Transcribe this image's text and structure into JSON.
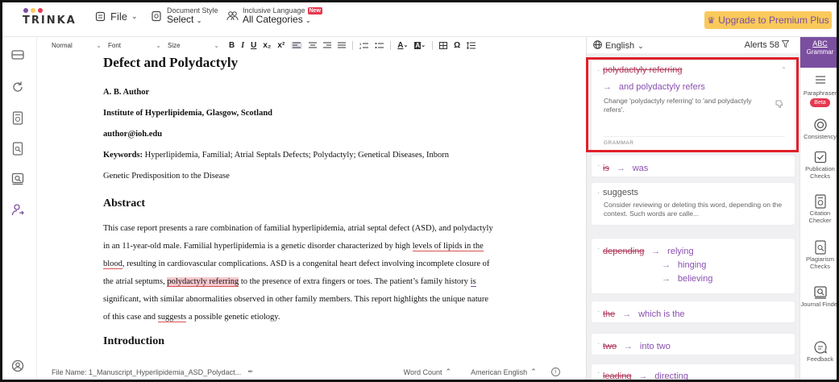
{
  "app": {
    "logo_text": "TRINKA",
    "logo_colors": [
      "#7b4fa0",
      "#f9c95b",
      "#e53950"
    ]
  },
  "topbar": {
    "file_label": "File",
    "doc_style_small": "Document Style",
    "doc_style_main": "Select",
    "inclusive_small": "Inclusive Language",
    "inclusive_badge": "New",
    "inclusive_main": "All Categories",
    "premium_label": "Upgrade to Premium Plus"
  },
  "format_toolbar": {
    "style_label": "Normal",
    "font_label": "Font",
    "size_label": "Size",
    "bold": "B",
    "italic": "I",
    "underline": "U",
    "subscript": "x₂",
    "superscript": "x²",
    "omega": "Ω"
  },
  "document": {
    "title": "Defect and Polydactyly",
    "author": "A. B. Author",
    "institute": "Institute of Hyperlipidemia, Glasgow, Scotland",
    "email": "author@ioh.edu",
    "keywords_label": "Keywords:",
    "keywords_text": " Hyperlipidemia, Familial; Atrial Septals Defects; Polydactyly; Genetical Diseases, Inborn",
    "keywords_line2": "Genetic Predisposition to the Disease",
    "abstract_heading": "Abstract",
    "abstract_lines": {
      "l1": "This case report presents a rare combination of familial hyperlipidemia, atrial septal defect (ASD), and polydactyly",
      "l2_a": "in an 11-year-old male. Familial hyperlipidemia is a genetic disorder characterized by high ",
      "l2_b": "levels of lipids in the",
      "l3_a": "blood",
      "l3_b": ", resulting in cardiovascular complications. ASD is a congenital heart defect involving incomplete closure of",
      "l4_a": "the atrial septums, ",
      "l4_hl": "polydactyly referring",
      "l4_b": " to the presence of extra fingers or toes. The patient’s family history ",
      "l4_c": "is",
      "l5": "significant, with similar abnormalities observed in other family members. This report highlights the unique nature",
      "l6_a": "of this case and ",
      "l6_b": "suggests",
      "l6_c": " a possible genetic etiology."
    },
    "intro_heading": "Introduction"
  },
  "statusbar": {
    "file_name": "File Name: 1_Manuscript_Hyperlipidemia_ASD_Polydact...",
    "word_count": "Word Count",
    "language": "American English"
  },
  "panel": {
    "language": "English",
    "alerts_label": "Alerts",
    "alerts_count": "58",
    "cards": [
      {
        "original": "polydactyly referring",
        "replacement": "and polydactyly refers",
        "description": "Change 'polydactyly referring' to 'and polydactyly refers'.",
        "tag": "GRAMMAR"
      },
      {
        "original": "is",
        "replacement": "was"
      },
      {
        "original": "suggests",
        "description": "Consider reviewing or deleting this word, depending on the context. Such words are calle..."
      },
      {
        "original": "depending",
        "replacements": [
          "relying",
          "hinging",
          "believing"
        ]
      },
      {
        "original": "the",
        "replacement": "which is the"
      },
      {
        "original": "two",
        "replacement": "into two"
      },
      {
        "original": "leading",
        "replacement": "directing"
      }
    ]
  },
  "right_rail": {
    "grammar_icon_text": "ABC",
    "grammar": "Grammar",
    "paraphraser": "Paraphraser",
    "beta": "Beta",
    "consistency": "Consistency",
    "publication": "Publication Checks",
    "citation": "Citation Checker",
    "plagiarism": "Plagiarism Checks",
    "journal": "Journal Finder",
    "feedback": "Feedback"
  }
}
